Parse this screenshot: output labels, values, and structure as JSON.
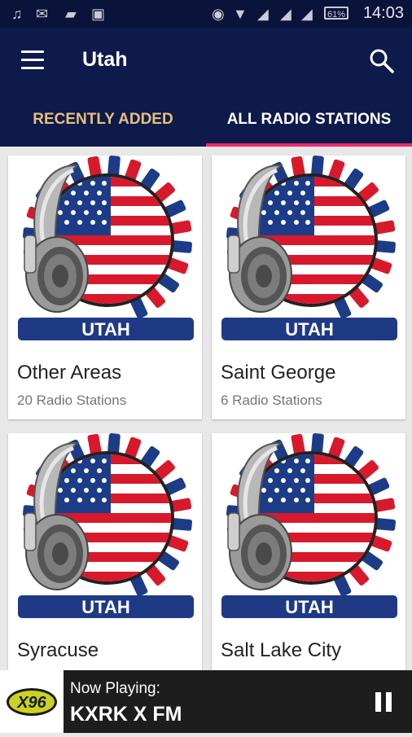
{
  "status_bar": {
    "time": "14:03",
    "battery": "61%"
  },
  "app_bar": {
    "title": "Utah",
    "menu_icon": "hamburger-menu-icon",
    "search_icon": "search-icon"
  },
  "tabs": [
    {
      "label": "RECENTLY ADDED",
      "selected": false
    },
    {
      "label": "ALL RADIO STATIONS",
      "selected": true
    }
  ],
  "cards": [
    {
      "name": "Other Areas",
      "count": "20 Radio Stations",
      "logo_text": "UTAH"
    },
    {
      "name": "Saint George",
      "count": "6 Radio Stations",
      "logo_text": "UTAH"
    },
    {
      "name": "Syracuse",
      "count": "",
      "logo_text": "UTAH"
    },
    {
      "name": "Salt Lake City",
      "count": "",
      "logo_text": "UTAH"
    }
  ],
  "player": {
    "now_label": "Now Playing:",
    "station": "KXRK X FM",
    "thumb_text": "X96",
    "state": "playing"
  },
  "colors": {
    "app_bar": "#0d1a4b",
    "status_bar": "#0a133a",
    "tab_indicator": "#ec2a6e",
    "recent_tab_text": "#e8c07a",
    "banner": "#1f3a85",
    "flag_red": "#d8192c",
    "flag_blue": "#1c3c88"
  }
}
